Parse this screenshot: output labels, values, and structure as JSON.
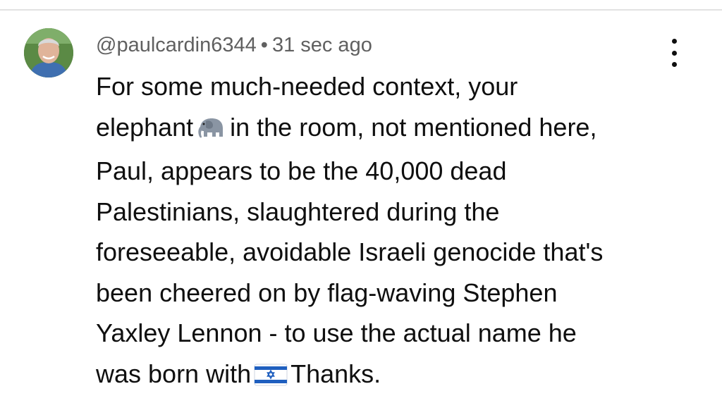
{
  "comment": {
    "author": "@paulcardin6344",
    "separator": "•",
    "timestamp": "31 sec ago",
    "avatar_icon": "profile-photo",
    "menu_icon": "vertical-ellipsis-icon",
    "lines": {
      "l1": "For some much-needed context, your",
      "l2_before": "elephant",
      "l2_after": "in the room, not mentioned here,",
      "l3": "Paul, appears to be the 40,000 dead",
      "l4": "Palestinians, slaughtered during the",
      "l5": "foreseeable, avoidable Israeli genocide that's",
      "l6": "been cheered on by flag-waving Stephen",
      "l7": "Yaxley Lennon - to use the actual name he",
      "l8_before": "was born with",
      "l8_after": "Thanks."
    },
    "emojis": [
      "elephant-emoji",
      "israel-flag-emoji"
    ]
  },
  "colors": {
    "text": "#0f0f0f",
    "meta_text": "#606060",
    "flag_blue": "#1f5fbf"
  }
}
